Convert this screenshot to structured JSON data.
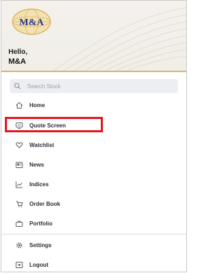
{
  "brand": {
    "logo_text": "M&A",
    "accent_color": "#d8b56a",
    "logo_text_color": "#2b3a8c"
  },
  "profile": {
    "greeting": "Hello,",
    "name": "M&A"
  },
  "search": {
    "placeholder": "Search Stock",
    "icon": "search-icon"
  },
  "menu": {
    "items": [
      {
        "label": "Home",
        "icon": "home-icon"
      },
      {
        "label": "Quote Screen",
        "icon": "monitor-icon",
        "highlighted": true
      },
      {
        "label": "Watchlist",
        "icon": "heart-icon"
      },
      {
        "label": "News",
        "icon": "news-icon"
      },
      {
        "label": "Indices",
        "icon": "chart-icon"
      },
      {
        "label": "Order Book",
        "icon": "orders-icon"
      },
      {
        "label": "Portfolio",
        "icon": "briefcase-icon"
      }
    ],
    "bottom_items": [
      {
        "label": "Settings",
        "icon": "gear-icon"
      },
      {
        "label": "Logout",
        "icon": "logout-icon"
      }
    ]
  },
  "highlight_color": "#e3161b"
}
